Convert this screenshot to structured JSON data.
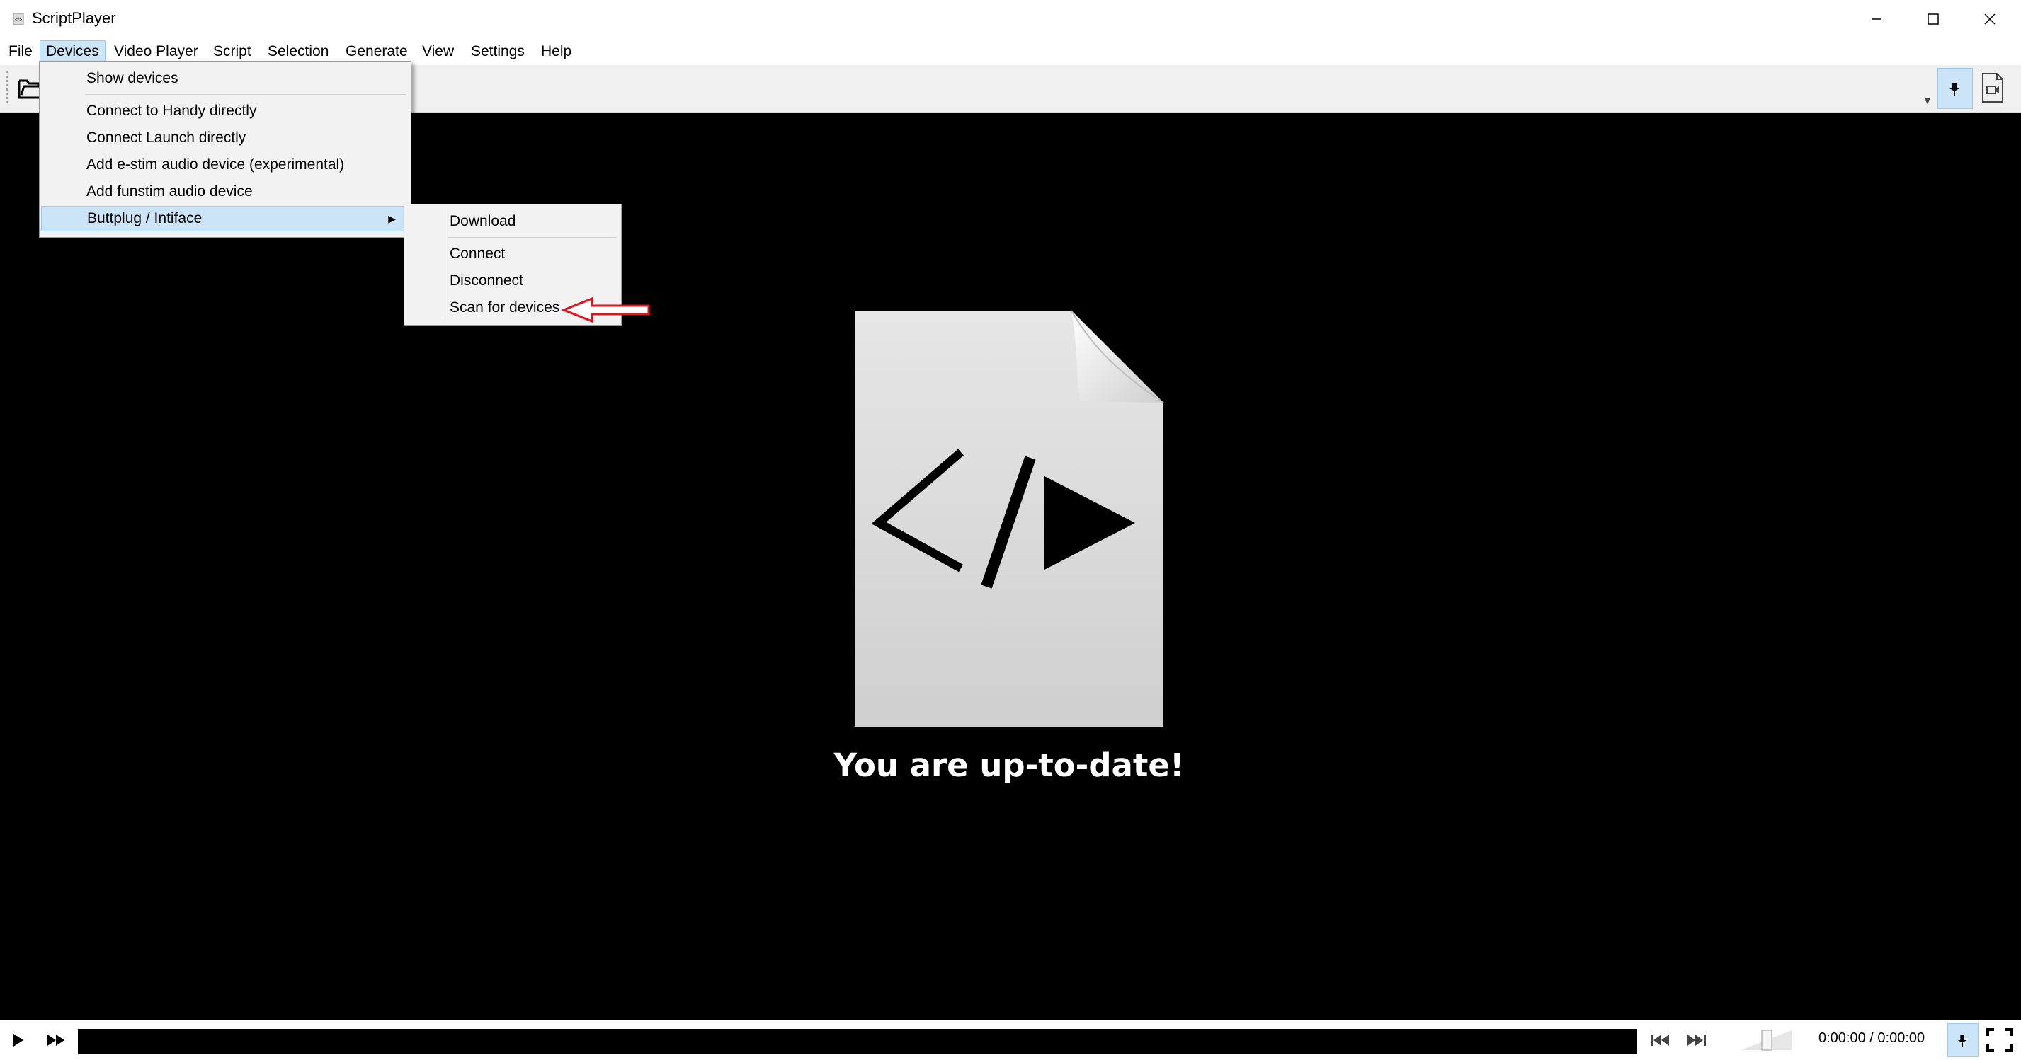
{
  "window": {
    "title": "ScriptPlayer"
  },
  "menubar": {
    "items": [
      {
        "label": "File"
      },
      {
        "label": "Devices"
      },
      {
        "label": "Video Player"
      },
      {
        "label": "Script"
      },
      {
        "label": "Selection"
      },
      {
        "label": "Generate"
      },
      {
        "label": "View"
      },
      {
        "label": "Settings"
      },
      {
        "label": "Help"
      }
    ],
    "active": "Devices"
  },
  "devices_menu": {
    "items": [
      {
        "label": "Show devices"
      },
      {
        "label": "Connect to Handy directly"
      },
      {
        "label": "Connect Launch directly"
      },
      {
        "label": "Add e-stim audio device (experimental)"
      },
      {
        "label": "Add funstim audio device"
      },
      {
        "label": "Buttplug / Intiface"
      }
    ],
    "highlighted": "Buttplug / Intiface"
  },
  "buttplug_submenu": {
    "items": [
      {
        "label": "Download"
      },
      {
        "label": "Connect"
      },
      {
        "label": "Disconnect"
      },
      {
        "label": "Scan for devices"
      }
    ]
  },
  "annotation": {
    "arrow_color": "#e0141e",
    "target": "Scan for devices"
  },
  "player": {
    "status_message": "You are up-to-date!",
    "logo_icon": "script-file-icon"
  },
  "playback": {
    "time_display": "0:00:00 / 0:00:00"
  },
  "colors": {
    "highlight_bg": "#cce4f7",
    "highlight_border": "#99c9ef",
    "player_bg": "#000000"
  }
}
